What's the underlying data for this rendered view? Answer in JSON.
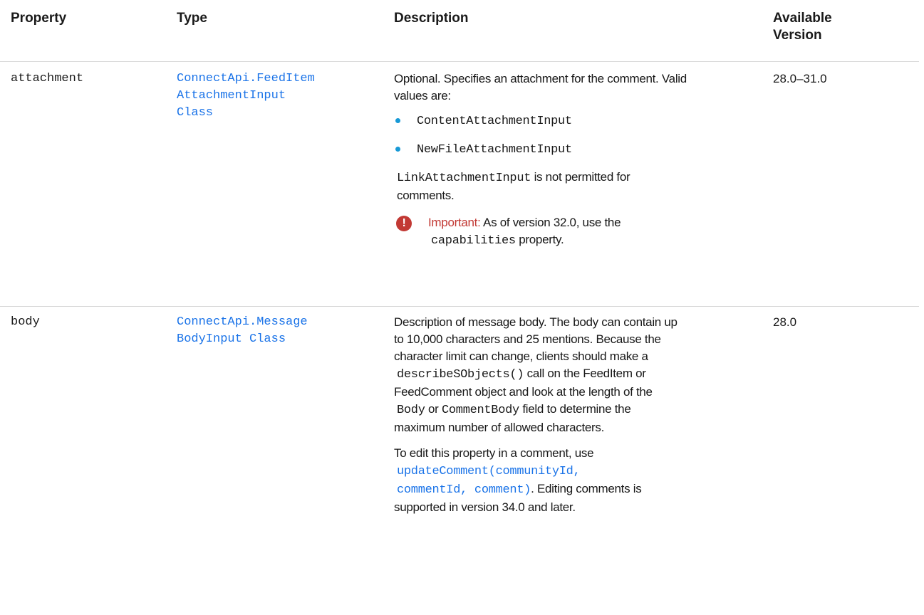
{
  "headers": {
    "property": "Property",
    "type": "Type",
    "description": "Description",
    "version_line1": "Available",
    "version_line2": "Version"
  },
  "rows": [
    {
      "property": "attachment",
      "type_line1": "ConnectApi.FeedItem",
      "type_line2": "AttachmentInput",
      "type_line3": "Class",
      "desc_intro_1": "Optional. Specifies an attachment for the comment. Valid",
      "desc_intro_2": "values are:",
      "bullets": [
        "ContentAttachmentInput",
        "NewFileAttachmentInput"
      ],
      "note_code": "LinkAttachmentInput",
      "note_text_1": " is not permitted for",
      "note_text_2": "comments.",
      "important_label": "Important:",
      "important_text_1": " As of version 32.0, use the",
      "important_code": "capabilities",
      "important_text_2": " property.",
      "version": "28.0–31.0"
    },
    {
      "property": "body",
      "type_line1": "ConnectApi.Message",
      "type_line2": "BodyInput Class",
      "desc_l1": "Description of message body. The body can contain up",
      "desc_l2": "to 10,000 characters and 25 mentions. Because the",
      "desc_l3": "character limit can change, clients should make a",
      "desc_l4_code": "describeSObjects()",
      "desc_l4_text": " call on the FeedItem or",
      "desc_l5": "FeedComment object and look at the length of the",
      "desc_l6_code1": "Body",
      "desc_l6_or": " or ",
      "desc_l6_code2": "CommentBody",
      "desc_l6_text": " field to determine the",
      "desc_l7": "maximum number of allowed characters.",
      "edit_l1": "To edit this property in a comment, use",
      "edit_link_1": "updateComment(communityId,",
      "edit_link_2": "commentId, comment)",
      "edit_after_link": ". Editing comments is",
      "edit_l4": "supported in version 34.0 and later.",
      "version": "28.0"
    }
  ],
  "colors": {
    "link": "#1a73e8",
    "bullet": "#1799d6",
    "important": "#c23934",
    "divider": "#d8d8d8"
  },
  "icons": {
    "important": "exclamation-circle-icon",
    "bullet": "bullet-dot-icon"
  }
}
